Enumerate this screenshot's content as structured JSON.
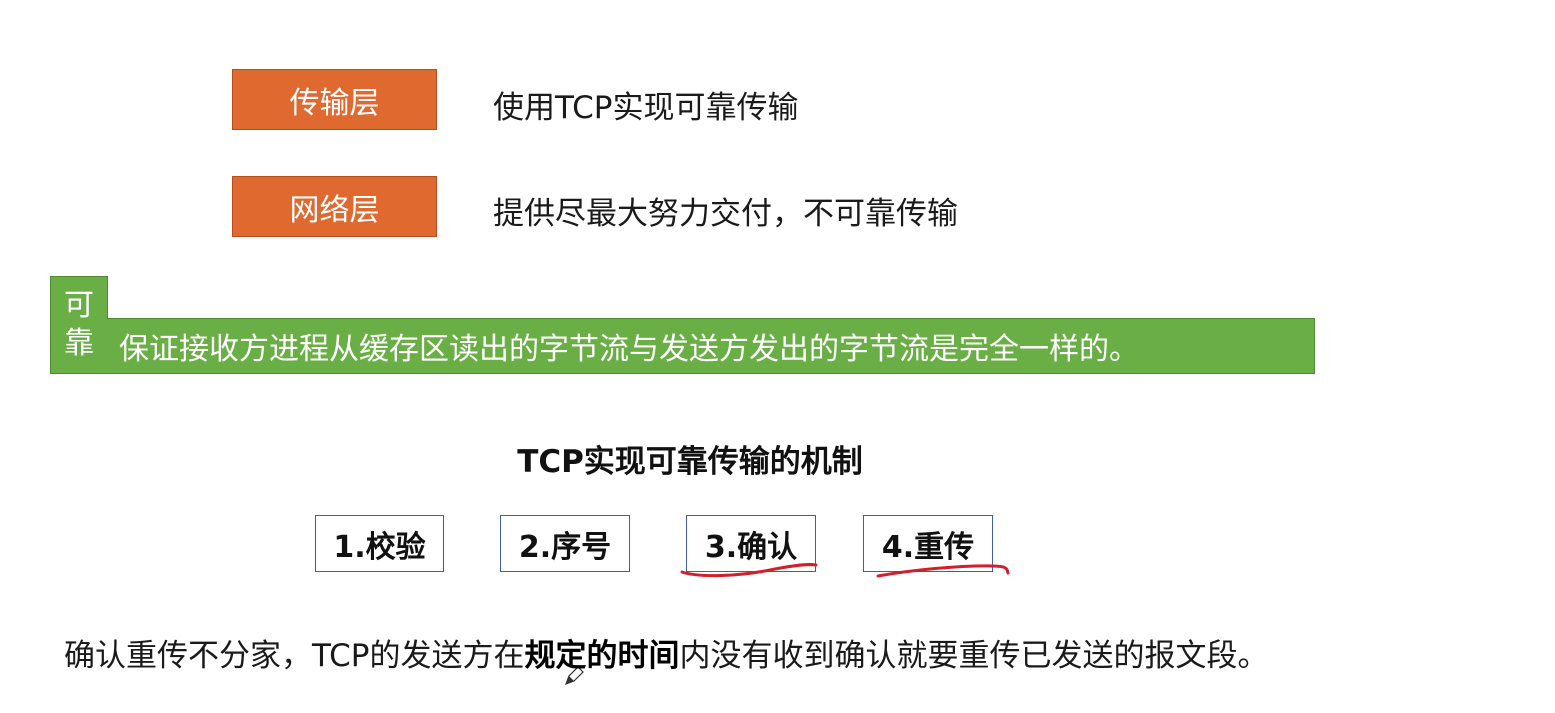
{
  "layers": [
    {
      "label": "传输层",
      "desc": "使用TCP实现可靠传输"
    },
    {
      "label": "网络层",
      "desc": "提供尽最大努力交付，不可靠传输"
    }
  ],
  "reliable": {
    "tag_chars": [
      "可",
      "靠"
    ],
    "definition": "保证接收方进程从缓存区读出的字节流与发送方发出的字节流是完全一样的。"
  },
  "mechanisms": {
    "title": "TCP实现可靠传输的机制",
    "items": [
      "1.校验",
      "2.序号",
      "3.确认",
      "4.重传"
    ]
  },
  "summary": {
    "before": "确认重传不分家，TCP的发送方在",
    "emphasis": "规定的时间",
    "after": "内没有收到确认就要重传已发送的报文段。"
  },
  "colors": {
    "layer_box": "#e0692f",
    "reliable_bar": "#6aaf45",
    "mechanism_border": "#3f5ea6",
    "annotation_ink": "#d0202a"
  }
}
